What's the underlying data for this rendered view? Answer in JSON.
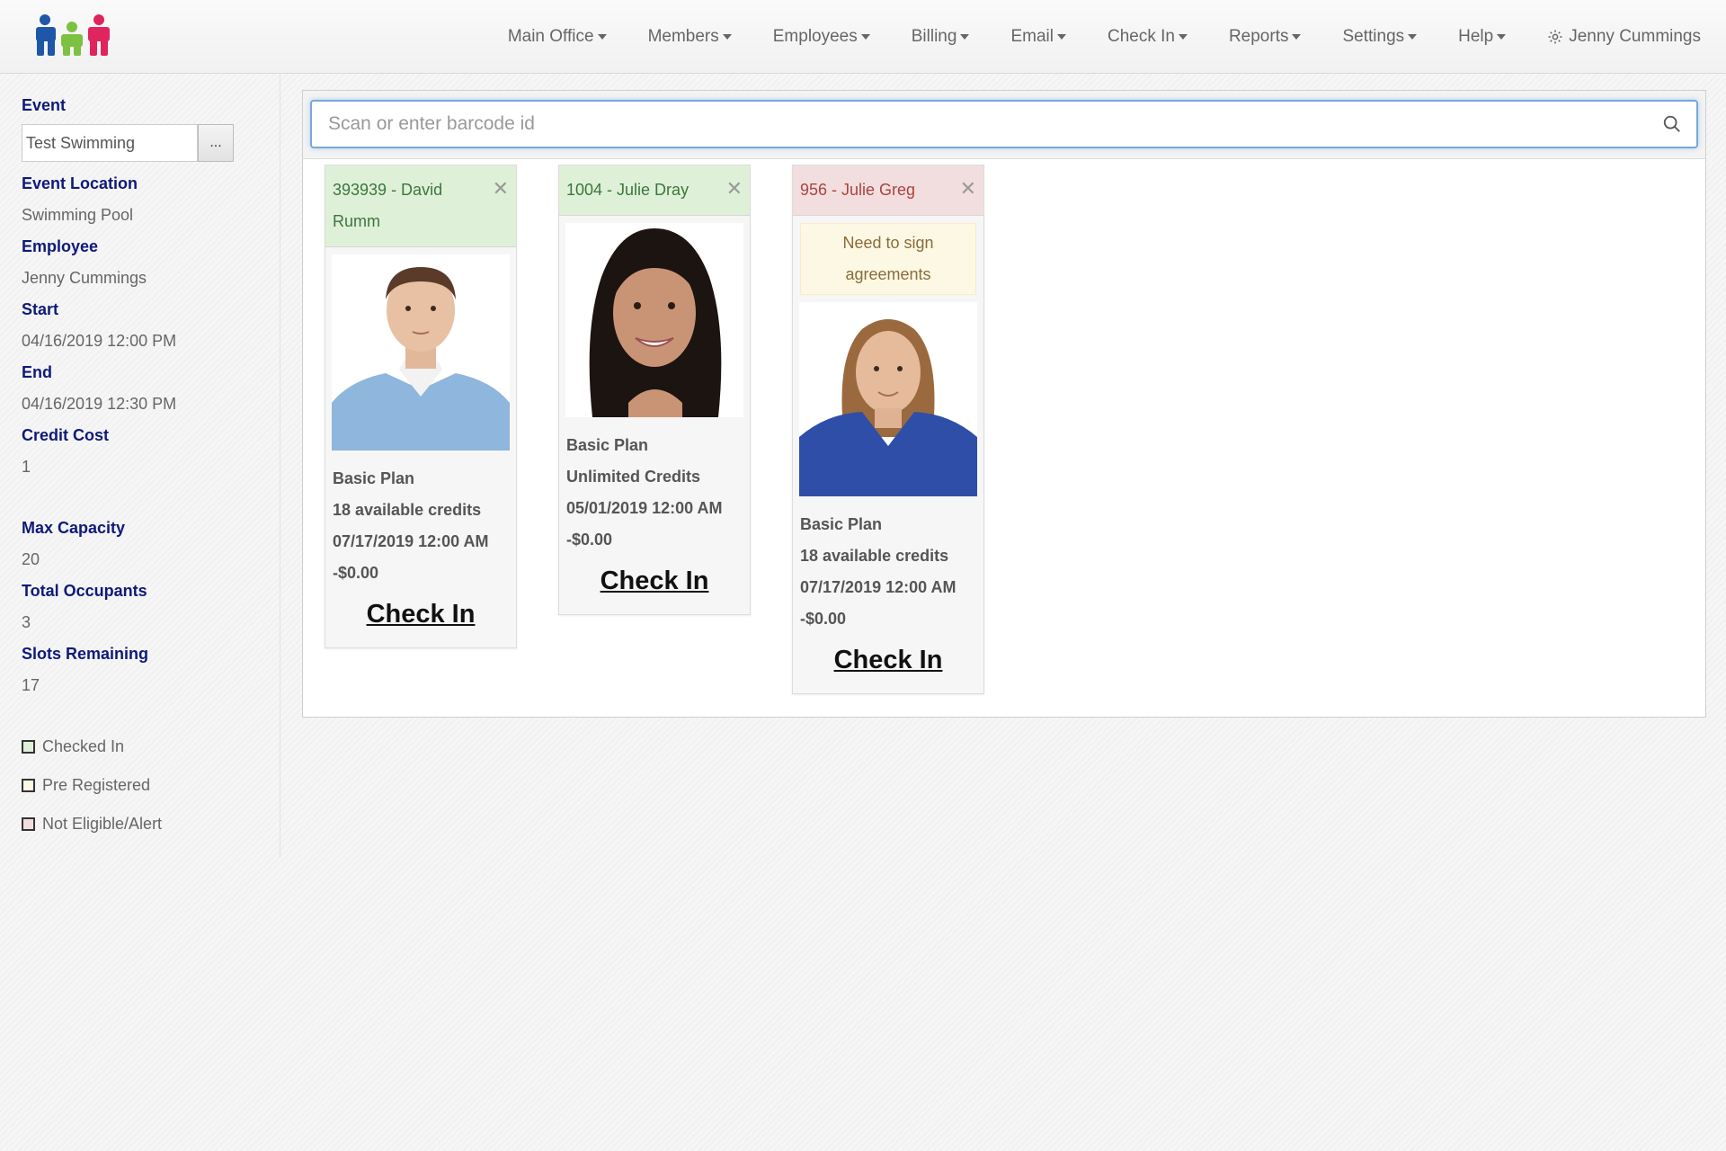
{
  "nav": {
    "items": [
      {
        "label": "Main Office"
      },
      {
        "label": "Members"
      },
      {
        "label": "Employees"
      },
      {
        "label": "Billing"
      },
      {
        "label": "Email"
      },
      {
        "label": "Check In"
      },
      {
        "label": "Reports"
      },
      {
        "label": "Settings"
      },
      {
        "label": "Help"
      }
    ],
    "user": "Jenny Cummings"
  },
  "sidebar": {
    "event_label": "Event",
    "event_value": "Test Swimming",
    "event_button": "...",
    "location_label": "Event Location",
    "location_value": "Swimming Pool",
    "employee_label": "Employee",
    "employee_value": "Jenny Cummings",
    "start_label": "Start",
    "start_value": "04/16/2019 12:00 PM",
    "end_label": "End",
    "end_value": "04/16/2019 12:30 PM",
    "credit_label": "Credit Cost",
    "credit_value": "1",
    "capacity_label": "Max Capacity",
    "capacity_value": "20",
    "occupants_label": "Total Occupants",
    "occupants_value": "3",
    "slots_label": "Slots Remaining",
    "slots_value": "17",
    "legend": [
      {
        "label": "Checked In",
        "color": "#dff0d8"
      },
      {
        "label": "Pre Registered",
        "color": "#fcf8e3"
      },
      {
        "label": "Not Eligible/Alert",
        "color": "#f2dede"
      }
    ]
  },
  "search": {
    "placeholder": "Scan or enter barcode id"
  },
  "cards": [
    {
      "name": "393939 - David Rumm",
      "status": "green",
      "lines": [
        "Basic Plan",
        "18 available credits",
        "07/17/2019 12:00 AM",
        "-$0.00"
      ],
      "button": "Check In"
    },
    {
      "name": "1004 - Julie Dray",
      "status": "green",
      "lines": [
        "Basic Plan",
        "Unlimited Credits",
        "05/01/2019 12:00 AM",
        "-$0.00"
      ],
      "button": "Check In"
    },
    {
      "name": "956 - Julie Greg",
      "status": "red",
      "alert": "Need to sign agreements",
      "lines": [
        "Basic Plan",
        "18 available credits",
        "07/17/2019 12:00 AM",
        "-$0.00"
      ],
      "button": "Check In"
    }
  ],
  "colors": {
    "accent_text": "#0e1a78",
    "checked_in": "#dff0d8",
    "alert": "#f2dede"
  }
}
